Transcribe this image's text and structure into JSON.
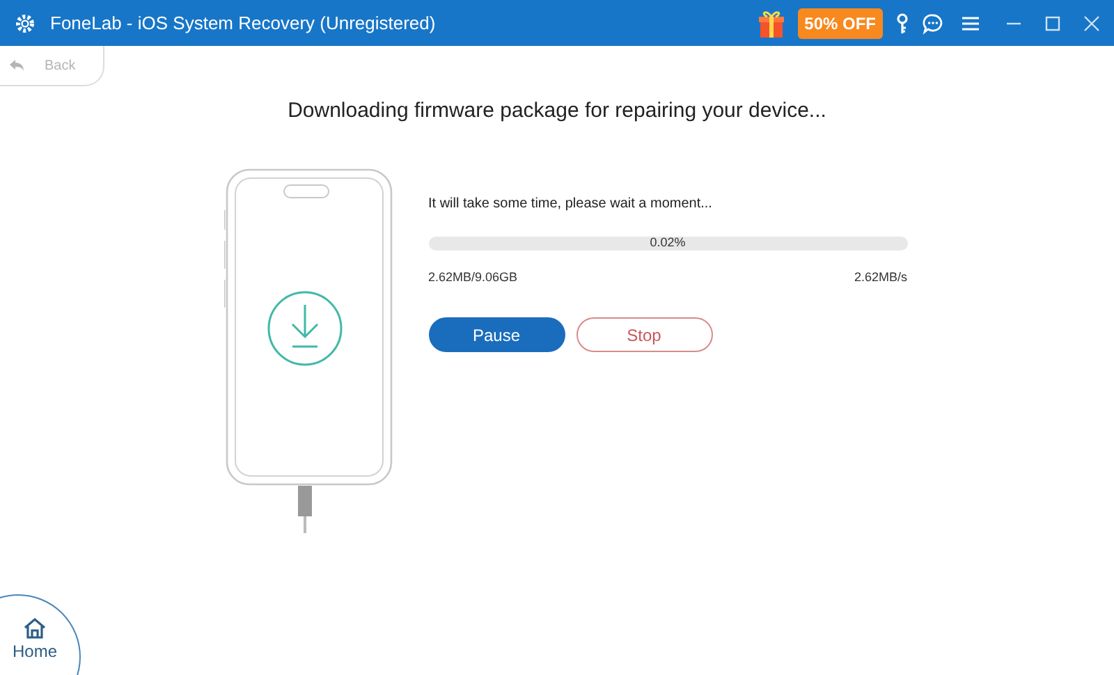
{
  "window": {
    "title": "FoneLab - iOS System Recovery (Unregistered)",
    "promo": "50% OFF"
  },
  "back": {
    "label": "Back",
    "disabled": true
  },
  "heading": "Downloading firmware package for repairing your device...",
  "download": {
    "message": "It will take some time, please wait a moment...",
    "progress": {
      "level": 0.0002,
      "reading": "0.02%"
    },
    "size": "2.62MB/9.06GB",
    "speed": "2.62MB/s"
  },
  "buttons": [
    {
      "label": "Pause",
      "kind": "primary"
    },
    {
      "label": "Stop",
      "kind": "outline"
    }
  ],
  "home": {
    "label": "Home"
  }
}
